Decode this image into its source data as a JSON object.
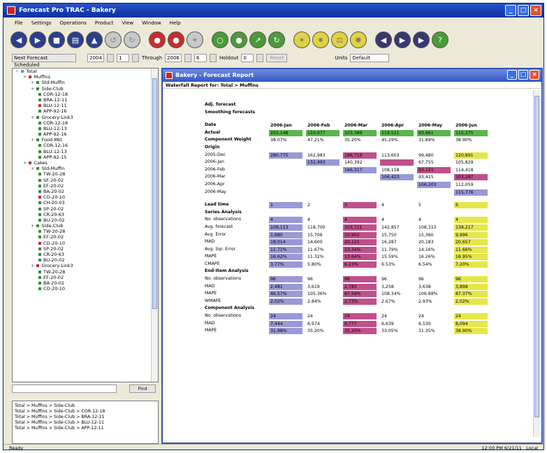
{
  "window": {
    "title": "Forecast Pro TRAC - Bakery"
  },
  "menu": [
    "File",
    "Settings",
    "Operations",
    "Product",
    "View",
    "Window",
    "Help"
  ],
  "toolbar": [
    {
      "name": "navy-nav-icon",
      "cls": "navy",
      "glyph": "◀"
    },
    {
      "name": "navy-nav-icon",
      "cls": "navy",
      "glyph": "▶"
    },
    {
      "name": "navy-print-icon",
      "cls": "navy",
      "glyph": "■"
    },
    {
      "name": "navy-save-icon",
      "cls": "navy",
      "glyph": "▤"
    },
    {
      "name": "navy-upload-icon",
      "cls": "navy",
      "glyph": "▲"
    },
    {
      "name": "gray-undo-icon",
      "cls": "gray",
      "glyph": "↺"
    },
    {
      "name": "gray-redo-icon",
      "cls": "gray",
      "glyph": "↻"
    },
    {
      "sep": true
    },
    {
      "name": "red-stop-icon",
      "cls": "red",
      "glyph": "●"
    },
    {
      "name": "red-record-icon",
      "cls": "red",
      "glyph": "●"
    },
    {
      "name": "gray-tool-icon",
      "cls": "gray",
      "glyph": "✦"
    },
    {
      "sep": true
    },
    {
      "name": "green-cycle-icon",
      "cls": "green",
      "glyph": "○"
    },
    {
      "name": "green-check-icon",
      "cls": "green",
      "glyph": "●"
    },
    {
      "name": "green-chart-icon",
      "cls": "green",
      "glyph": "↗"
    },
    {
      "name": "green-refresh-icon",
      "cls": "green",
      "glyph": "↻"
    },
    {
      "sep": true
    },
    {
      "name": "yellow-star-icon",
      "cls": "yellow",
      "glyph": "✶"
    },
    {
      "name": "yellow-burst-icon",
      "cls": "yellow",
      "glyph": "✷"
    },
    {
      "name": "yellow-scale-icon",
      "cls": "yellow",
      "glyph": "⚖"
    },
    {
      "name": "yellow-gear-icon",
      "cls": "yellow",
      "glyph": "✺"
    },
    {
      "sep": true
    },
    {
      "name": "purple-back-icon",
      "cls": "purple",
      "glyph": "◀"
    },
    {
      "name": "purple-forward-icon",
      "cls": "purple",
      "glyph": "▶"
    },
    {
      "name": "purple-end-icon",
      "cls": "purple",
      "glyph": "▶"
    },
    {
      "name": "green-help-icon",
      "cls": "green",
      "glyph": "?"
    }
  ],
  "params": {
    "item": "Next Forecast Scheduled",
    "start_year": "2004",
    "start_period": "1",
    "through_label": "Through",
    "through_year": "2006",
    "through_period": "6",
    "holdout_label": "Holdout",
    "holdout_value": "0",
    "reset_label": "Reset",
    "units_label": "Units",
    "units_value": "Default"
  },
  "tree": [
    {
      "t": "Total",
      "lvl": 0,
      "m": "−"
    },
    {
      "t": "Muffins",
      "lvl": 1,
      "m": "+",
      "col": "#c03030"
    },
    {
      "t": "Std-Muffin",
      "lvl": 2,
      "m": "+",
      "col": "#3a8a3a"
    },
    {
      "t": "Side-Club",
      "lvl": 2,
      "m": "+",
      "col": "#3a8a3a"
    },
    {
      "t": "COR-12-18",
      "lvl": 3,
      "col": "#3a8a3a"
    },
    {
      "t": "BRA-12-11",
      "lvl": 3,
      "col": "#3a8a3a"
    },
    {
      "t": "BLU-12-11",
      "lvl": 3,
      "col": "#c03030"
    },
    {
      "t": "APP-92-16",
      "lvl": 3,
      "col": "#3a8a3a"
    },
    {
      "t": "Grocery-Link3",
      "lvl": 2,
      "m": "+",
      "col": "#3a8a3a"
    },
    {
      "t": "COR-12-18",
      "lvl": 3,
      "col": "#3a8a3a"
    },
    {
      "t": "BLU-12-13",
      "lvl": 3,
      "col": "#3a8a3a"
    },
    {
      "t": "APP-92-16",
      "lvl": 3,
      "col": "#3a8a3a"
    },
    {
      "t": "Food-Mkt",
      "lvl": 2,
      "m": "+",
      "col": "#3a8a3a"
    },
    {
      "t": "COR-12-16",
      "lvl": 3,
      "col": "#3a8a3a"
    },
    {
      "t": "BLU-12-13",
      "lvl": 3,
      "col": "#3a8a3a"
    },
    {
      "t": "APP-92-15",
      "lvl": 3,
      "col": "#3a8a3a"
    },
    {
      "t": "Cakes",
      "lvl": 1,
      "m": "+",
      "col": "#c03030"
    },
    {
      "t": "Std-Muffin",
      "lvl": 2,
      "m": "+",
      "col": "#3a8a3a"
    },
    {
      "t": "TW-20-28",
      "lvl": 3,
      "col": "#3a8a3a"
    },
    {
      "t": "SF-20-02",
      "lvl": 3,
      "col": "#3a8a3a"
    },
    {
      "t": "EF-20-02",
      "lvl": 3,
      "col": "#3a8a3a"
    },
    {
      "t": "BA-20-02",
      "lvl": 3,
      "col": "#3a8a3a"
    },
    {
      "t": "CO-20-10",
      "lvl": 3,
      "col": "#c03030"
    },
    {
      "t": "CH-20-03",
      "lvl": 3,
      "col": "#3a8a3a"
    },
    {
      "t": "SP-20-02",
      "lvl": 3,
      "col": "#3a8a3a"
    },
    {
      "t": "CR-20-63",
      "lvl": 3,
      "col": "#3a8a3a"
    },
    {
      "t": "BU-20-02",
      "lvl": 3,
      "col": "#3a8a3a"
    },
    {
      "t": "Side-Club",
      "lvl": 2,
      "m": "+",
      "col": "#3a8a3a"
    },
    {
      "t": "TW-20-28",
      "lvl": 3,
      "col": "#3a8a3a"
    },
    {
      "t": "EF-20-02",
      "lvl": 3,
      "col": "#3a8a3a"
    },
    {
      "t": "CO-20-10",
      "lvl": 3,
      "col": "#c03030"
    },
    {
      "t": "SP-20-02",
      "lvl": 3,
      "col": "#3a8a3a"
    },
    {
      "t": "CR-20-63",
      "lvl": 3,
      "col": "#3a8a3a"
    },
    {
      "t": "BU-20-02",
      "lvl": 3,
      "col": "#3a8a3a"
    },
    {
      "t": "Grocery-Link3",
      "lvl": 2,
      "m": "+",
      "col": "#c03030"
    },
    {
      "t": "TW-20-28",
      "lvl": 3,
      "col": "#3a8a3a"
    },
    {
      "t": "EF-20-02",
      "lvl": 3,
      "col": "#3a8a3a"
    },
    {
      "t": "BA-20-02",
      "lvl": 3,
      "col": "#3a8a3a"
    },
    {
      "t": "CO-20-10",
      "lvl": 3,
      "col": "#3a8a3a"
    }
  ],
  "search": {
    "button": "Find"
  },
  "paths": [
    "Total > Muffins > Side-Club",
    "Total > Muffins > Side-Club > COR-12-18",
    "Total > Muffins > Side-Club > BRA-12-11",
    "Total > Muffins > Side-Club > BLU-12-11",
    "Total > Muffins > Side-Club > APP-12-11"
  ],
  "report": {
    "title": "Bakery - Forecast Report",
    "subtitle": "Waterfall Report for: Total > Muffins",
    "headers": [
      "Date",
      "2006-Jan",
      "2006-Feb",
      "2006-Mar",
      "2006-Apr",
      "2006-May",
      "2006-Jun"
    ],
    "rows": [
      {
        "lab": "Adj. forecast",
        "b": 1
      },
      {
        "lab": "Smoothing forecasts",
        "b": 1
      },
      {
        "gap": 1
      },
      {
        "hdr": 1
      },
      {
        "lab": "Actual",
        "b": 1,
        "v": [
          "202,148",
          "110,977",
          "103,389",
          "119,511",
          "93,661",
          "115,275"
        ],
        "cl": [
          "g",
          "g",
          "g",
          "g",
          "g",
          "g"
        ]
      },
      {
        "lab": "Component Weight",
        "b": 1,
        "v": [
          "38.07%",
          "47.21%",
          "35.20%",
          "45.29%",
          "31.69%",
          "38.90%"
        ]
      },
      {
        "lab": "Origin",
        "b": 1
      },
      {
        "lab": "2005-Dec",
        "v": [
          "280,775",
          "162,983",
          "186,719",
          "113,603",
          "99,480",
          "120,891"
        ],
        "cl": [
          "p",
          "",
          "m",
          "",
          "",
          "y"
        ]
      },
      {
        "lab": "2006-Jan",
        "v": [
          "",
          "132,493",
          "140,392",
          "",
          "67,755",
          "105,829"
        ],
        "cl": [
          "",
          "p",
          "",
          "m",
          "",
          ""
        ]
      },
      {
        "lab": "2006-Feb",
        "v": [
          "",
          "",
          "166,317",
          "108,158",
          "93,121",
          "114,418"
        ],
        "cl": [
          "",
          "",
          "p",
          "",
          "m",
          ""
        ]
      },
      {
        "lab": "2006-Mar",
        "v": [
          "",
          "",
          "",
          "106,423",
          "93,415",
          "103,287"
        ],
        "cl": [
          "",
          "",
          "",
          "p",
          "",
          "m"
        ]
      },
      {
        "lab": "2006-Apr",
        "v": [
          "",
          "",
          "",
          "",
          "106,203",
          "112,059"
        ],
        "cl": [
          "",
          "",
          "",
          "",
          "p",
          ""
        ]
      },
      {
        "lab": "2006-May",
        "v": [
          "",
          "",
          "",
          "",
          "",
          "115,776"
        ],
        "cl": [
          "",
          "",
          "",
          "",
          "",
          "p"
        ]
      },
      {
        "gap": 1
      },
      {
        "lab": "Lead time",
        "b": 1,
        "v": [
          "1",
          "2",
          "3",
          "4",
          "5",
          "6"
        ],
        "cl": [
          "p",
          "",
          "m",
          "",
          "",
          "y"
        ]
      },
      {
        "lab": "Series Analysis",
        "b": 1
      },
      {
        "lab": "No. observations",
        "v": [
          "4",
          "4",
          "4",
          "4",
          "4",
          "4"
        ],
        "cl": [
          "p",
          "",
          "m",
          "",
          "",
          "y"
        ]
      },
      {
        "lab": "Avg. forecast",
        "v": [
          "109,113",
          "118,700",
          "103,721",
          "142,857",
          "108,313",
          "138,217"
        ],
        "cl": [
          "p",
          "",
          "m",
          "",
          "",
          "y"
        ]
      },
      {
        "lab": "Avg. Error",
        "v": [
          "1,980",
          "15,706",
          "10,902",
          "15,750",
          "15,360",
          "9,996"
        ],
        "cl": [
          "p",
          "",
          "m",
          "",
          "",
          "y"
        ]
      },
      {
        "lab": "MAD",
        "v": [
          "18,014",
          "14,600",
          "20,121",
          "16,287",
          "20,183",
          "20,657"
        ],
        "cl": [
          "p",
          "",
          "m",
          "",
          "",
          "y"
        ]
      },
      {
        "lab": "Avg. Sqr. Error",
        "v": [
          "11.71%",
          "11.67%",
          "13.34%",
          "11.79%",
          "14.16%",
          "11.66%"
        ],
        "cl": [
          "p",
          "",
          "m",
          "",
          "",
          "y"
        ]
      },
      {
        "lab": "MAPE",
        "v": [
          "16.62%",
          "11.32%",
          "13.64%",
          "15.59%",
          "16.26%",
          "16.95%"
        ],
        "cl": [
          "p",
          "",
          "m",
          "",
          "",
          "y"
        ]
      },
      {
        "lab": "CMAPE",
        "v": [
          "3.77%",
          "5.80%",
          "6.23%",
          "6.53%",
          "6.54%",
          "7.20%"
        ],
        "cl": [
          "p",
          "",
          "m",
          "",
          "",
          "y"
        ]
      },
      {
        "lab": "End-Item Analysis",
        "b": 1
      },
      {
        "lab": "No. observations",
        "v": [
          "96",
          "96",
          "96",
          "96",
          "96",
          "96"
        ],
        "cl": [
          "p",
          "",
          "m",
          "",
          "",
          "y"
        ]
      },
      {
        "lab": "MAD",
        "v": [
          "2,481",
          "3,619",
          "2,783",
          "3,258",
          "3,638",
          "3,898"
        ],
        "cl": [
          "p",
          "",
          "m",
          "",
          "",
          "y"
        ]
      },
      {
        "lab": "MAPE",
        "v": [
          "46.57%",
          "105.36%",
          "87.59%",
          "108.34%",
          "106.88%",
          "87.37%"
        ],
        "cl": [
          "p",
          "",
          "m",
          "",
          "",
          "y"
        ]
      },
      {
        "lab": "WMAPE",
        "v": [
          "2.02%",
          "2.84%",
          "2.73%",
          "2.67%",
          "2.93%",
          "2.02%"
        ],
        "cl": [
          "p",
          "",
          "m",
          "",
          "",
          "y"
        ]
      },
      {
        "lab": "Component Analysis",
        "b": 1
      },
      {
        "lab": "No. observations",
        "v": [
          "24",
          "24",
          "24",
          "24",
          "24",
          "24"
        ],
        "cl": [
          "p",
          "",
          "m",
          "",
          "",
          "y"
        ]
      },
      {
        "lab": "MAD",
        "v": [
          "7,444",
          "6,974",
          "6,777",
          "6,639",
          "6,530",
          "8,094"
        ],
        "cl": [
          "p",
          "",
          "m",
          "",
          "",
          "y"
        ]
      },
      {
        "lab": "MAPE",
        "v": [
          "31.98%",
          "35.20%",
          "35.20%",
          "33.05%",
          "31.35%",
          "38.90%"
        ],
        "cl": [
          "p",
          "",
          "m",
          "",
          "",
          "y"
        ]
      }
    ]
  },
  "status": {
    "left": "Ready",
    "right": "12:00 PM  6/21/11",
    "extra": "Local"
  }
}
